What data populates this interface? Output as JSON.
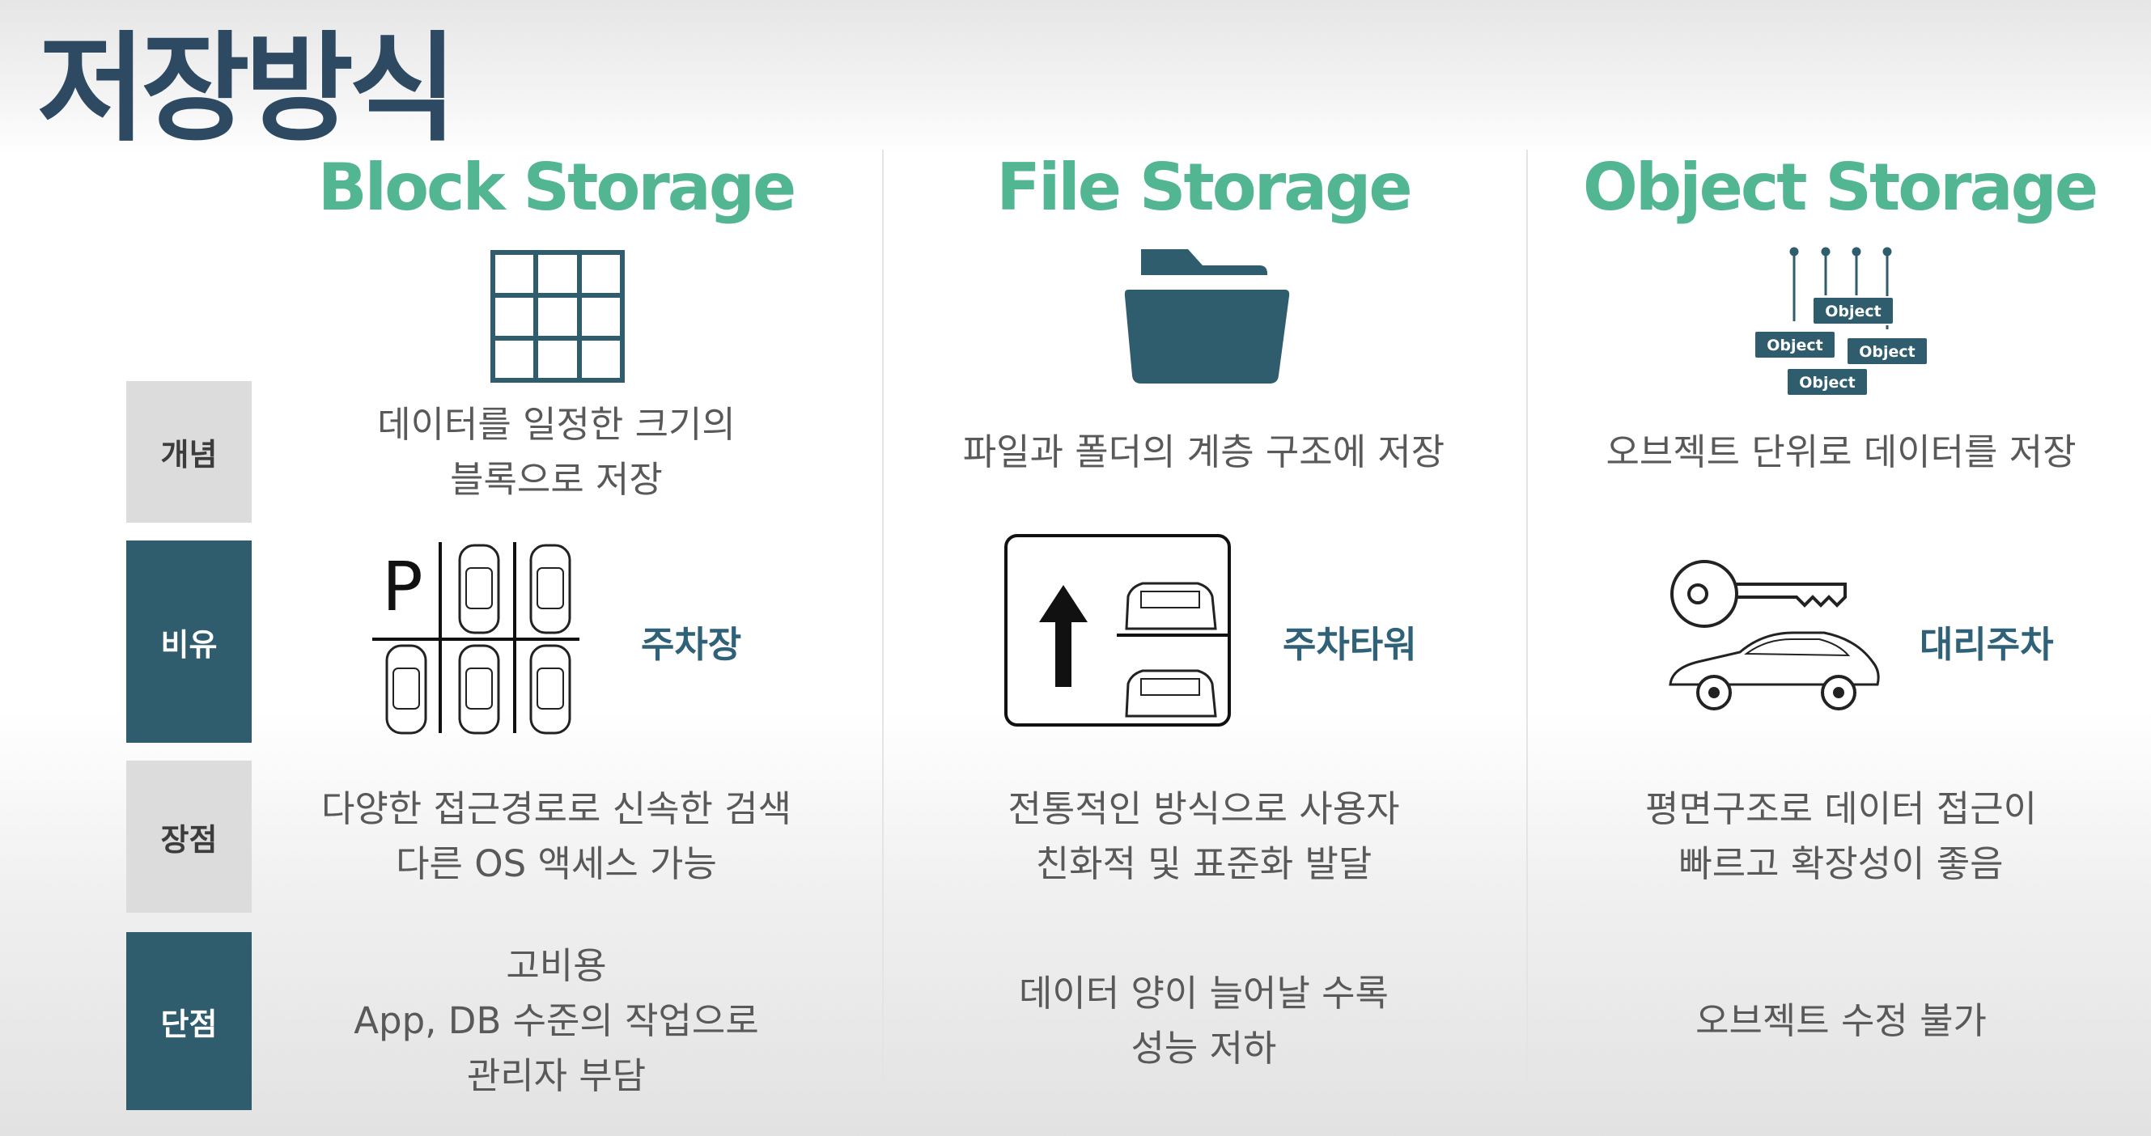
{
  "title": "저장방식",
  "columns": [
    {
      "title": "Block Storage",
      "icon": "grid-icon",
      "concept": [
        "데이터를 일정한 크기의",
        "블록으로 저장"
      ],
      "analogy": "주차장",
      "analogy_icon": "parking-lot-icon",
      "pros": [
        "다양한 접근경로로 신속한 검색",
        "다른 OS 액세스 가능"
      ],
      "cons": [
        "고비용",
        "App, DB 수준의 작업으로",
        "관리자 부담"
      ]
    },
    {
      "title": "File Storage",
      "icon": "folder-icon",
      "concept": [
        "파일과 폴더의 계층 구조에 저장"
      ],
      "analogy": "주차타워",
      "analogy_icon": "parking-tower-icon",
      "pros": [
        "전통적인 방식으로 사용자",
        "친화적 및 표준화 발달"
      ],
      "cons": [
        "데이터 양이 늘어날 수록",
        "성능 저하"
      ]
    },
    {
      "title": "Object Storage",
      "icon": "object-tree-icon",
      "object_label": "Object",
      "concept": [
        "오브젝트 단위로 데이터를 저장"
      ],
      "analogy": "대리주차",
      "analogy_icon": "key-car-icon",
      "pros": [
        "평면구조로 데이터 접근이",
        "빠르고 확장성이 좋음"
      ],
      "cons": [
        "오브젝트 수정 불가"
      ]
    }
  ],
  "rows": {
    "concept": "개념",
    "analogy": "비유",
    "pros": "장점",
    "cons": "단점"
  },
  "colors": {
    "title": "#2e4a63",
    "accent": "#52b692",
    "dark_label": "#2f5d6e",
    "light_label": "#dcdcdc"
  }
}
